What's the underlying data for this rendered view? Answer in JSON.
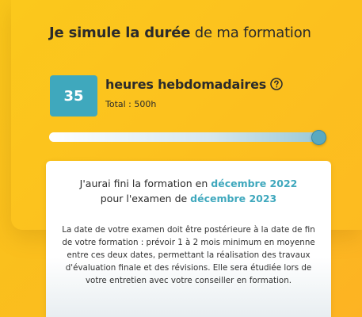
{
  "simulator": {
    "title_bold": "Je simule la durée",
    "title_rest": " de ma formation",
    "hours_value": "35",
    "hours_label": "heures hebdomadaires",
    "help_icon": "question-circle-icon",
    "total_text": "Total : 500h",
    "slider_level": 1.0
  },
  "result": {
    "line1_prefix": "J'aurai fini la formation en ",
    "end_date": "décembre 2022",
    "line2_prefix": "pour l'examen de ",
    "exam_date": "décembre 2023",
    "note": "La date de votre examen doit être postérieure à la date de fin de votre formation : prévoir 1 à 2 mois minimum en moyenne entre ces deux dates, permettant la réalisation des travaux d'évaluation finale et des révisions. Elle sera étudiée lors de votre entretien avec votre conseiller en formation."
  },
  "colors": {
    "background": "#fbbd1e",
    "accent": "#3fa8bd",
    "text": "#2b2b2b"
  }
}
